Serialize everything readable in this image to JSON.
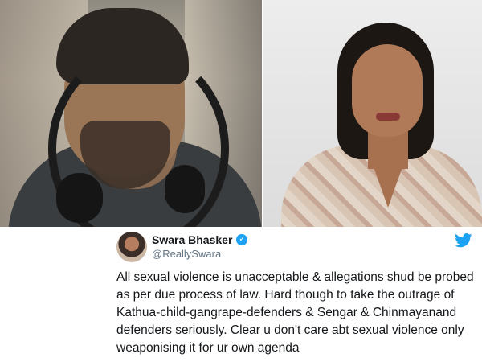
{
  "photos": {
    "left": {
      "alt": ""
    },
    "right": {
      "alt": ""
    }
  },
  "tweet": {
    "display_name": "Swara Bhasker",
    "handle": "@ReallySwara",
    "verified_icon": "verified-badge-icon",
    "logo_icon": "twitter-bird-icon",
    "accent_color": "#1da1f2",
    "text": "All sexual violence is unacceptable & allegations shud be probed as per due process of law. Hard though to take the outrage of Kathua-child-gangrape-defenders & Sengar & Chinmayanand defenders seriously. Clear u don't care abt sexual violence only weaponising it for ur own agenda"
  }
}
